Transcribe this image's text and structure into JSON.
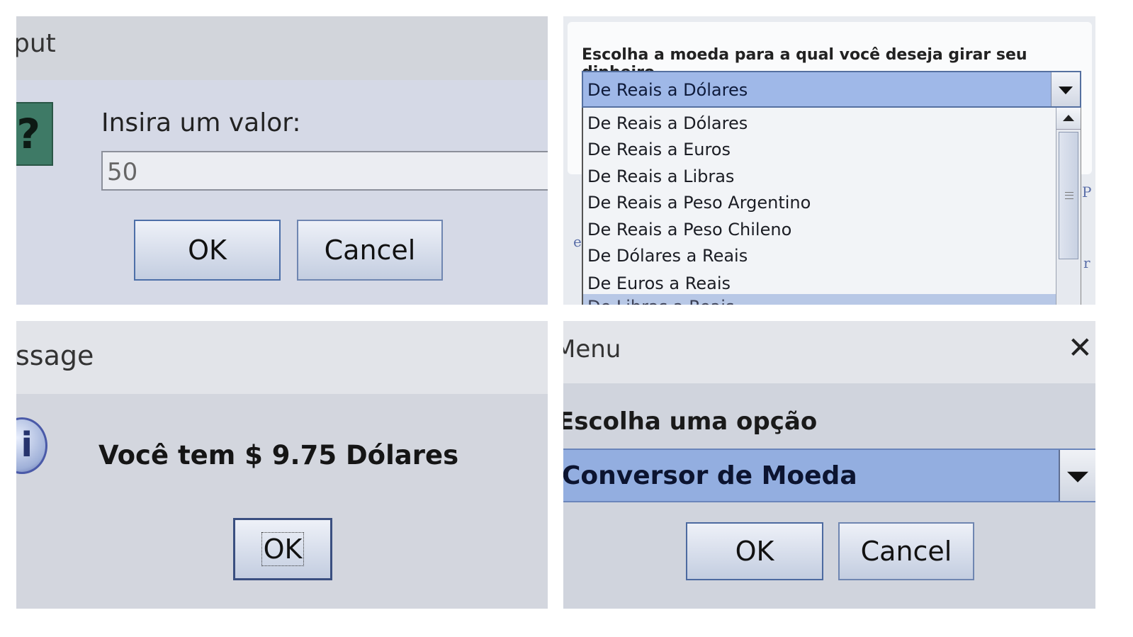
{
  "input_dialog": {
    "title_fragment": "put",
    "icon": "question-icon",
    "icon_glyph": "?",
    "prompt": "Insira um valor:",
    "input_value": "50",
    "ok_label": "OK",
    "cancel_label": "Cancel"
  },
  "currency_select": {
    "label": "Escolha a moeda para a qual você deseja girar seu dinheiro",
    "selected": "De Reais a Dólares",
    "options": [
      "De Reais a Dólares",
      "De Reais a Euros",
      "De Reais a Libras",
      "De Reais a Peso Argentino",
      "De Reais a Peso Chileno",
      "De Dólares a Reais",
      "De Euros a Reais"
    ],
    "partial_option": "De Libras a Reais",
    "background_fragments": [
      "e",
      "P",
      "r"
    ]
  },
  "message_dialog": {
    "title_fragment": "ssage",
    "icon": "info-icon",
    "icon_glyph": "i",
    "message": "Você tem $ 9.75 Dólares",
    "ok_label": "OK"
  },
  "menu_dialog": {
    "title_fragment": "Menu",
    "close_glyph": "✕",
    "label": "Escolha uma opção",
    "selected": "Conversor de Moeda",
    "ok_label": "OK",
    "cancel_label": "Cancel"
  },
  "colors": {
    "selection_blue": "#9fb8e8",
    "button_border": "#6f86b1",
    "question_icon": "#3e7a66"
  }
}
